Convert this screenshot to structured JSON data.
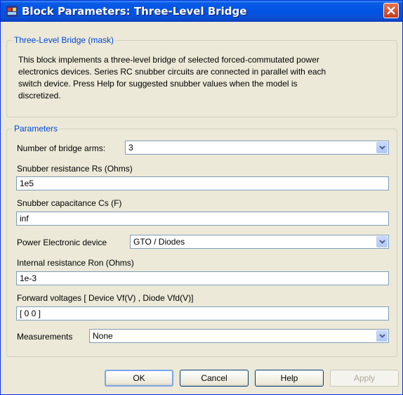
{
  "window": {
    "title": "Block Parameters: Three-Level Bridge"
  },
  "mask": {
    "legend": "Three-Level Bridge (mask)",
    "lines": [
      "This block implements a three-level bridge of selected forced-commutated power",
      "electronics devices.  Series RC snubber circuits are connected in parallel with each",
      "switch device.  Press Help for suggested snubber values when the model is",
      "discretized."
    ]
  },
  "params": {
    "legend": "Parameters",
    "bridge_arms": {
      "label": "Number of bridge arms:",
      "value": "3"
    },
    "snubber_rs": {
      "label": "Snubber resistance Rs (Ohms)",
      "value": "1e5"
    },
    "snubber_cs": {
      "label": "Snubber capacitance Cs (F)",
      "value": "inf"
    },
    "device": {
      "label": "Power Electronic device",
      "value": "GTO / Diodes"
    },
    "ron": {
      "label": "Internal resistance Ron (Ohms)",
      "value": "1e-3"
    },
    "vf": {
      "label": "Forward voltages  [ Device Vf(V) , Diode Vfd(V)]",
      "value": "[ 0 0 ]"
    },
    "measurements": {
      "label": "Measurements",
      "value": "None"
    }
  },
  "buttons": {
    "ok": "OK",
    "cancel": "Cancel",
    "help": "Help",
    "apply": "Apply"
  },
  "colors": {
    "title_bar": "#0054e3",
    "legend_text": "#0046d5",
    "dialog_bg": "#ece9d8"
  }
}
